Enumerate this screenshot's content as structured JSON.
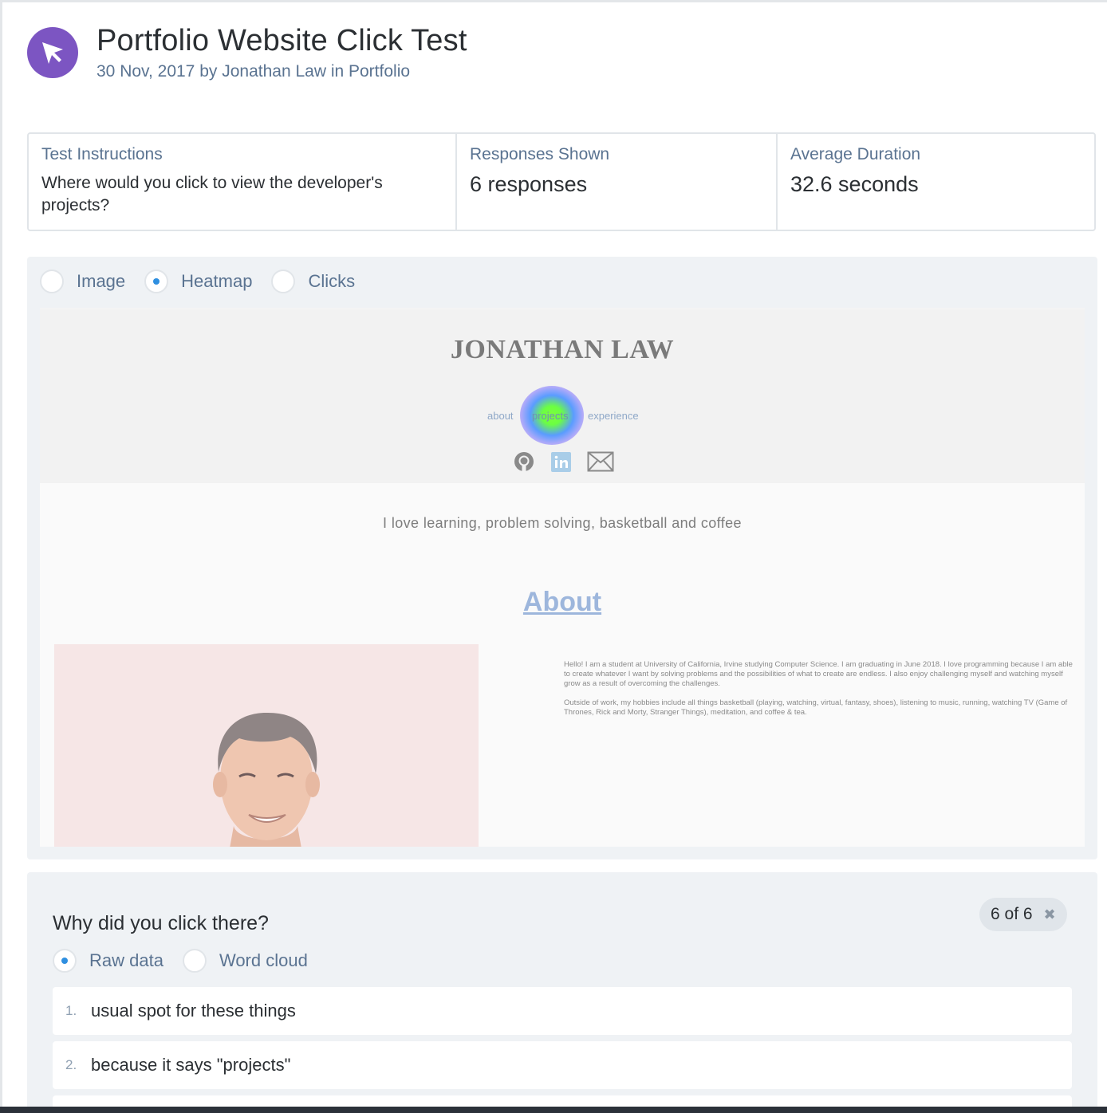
{
  "header": {
    "icon": "cursor-arrow-icon",
    "title": "Portfolio Website Click Test",
    "meta": "30 Nov, 2017 by Jonathan Law in Portfolio",
    "accent_color": "#7c55c2"
  },
  "stats": {
    "instructions_label": "Test Instructions",
    "instructions_text": "Where would you click to view the developer's projects?",
    "responses_label": "Responses Shown",
    "responses_value": "6 responses",
    "duration_label": "Average Duration",
    "duration_value": "32.6 seconds"
  },
  "view": {
    "options": [
      {
        "label": "Image",
        "selected": false
      },
      {
        "label": "Heatmap",
        "selected": true
      },
      {
        "label": "Clicks",
        "selected": false
      }
    ]
  },
  "screenshot": {
    "name": "JONATHAN LAW",
    "nav": [
      "about",
      "projects",
      "experience"
    ],
    "social_icons": [
      "github-icon",
      "linkedin-icon",
      "mail-icon"
    ],
    "tagline": "I love learning, problem solving, basketball and coffee",
    "about_heading": "About",
    "bio_1": "Hello! I am a student at University of California, Irvine studying Computer Science. I am graduating in June 2018. I love programming because I am able to create whatever I want by solving problems and the possibilities of what to create are endless. I also enjoy challenging myself and watching myself grow as a result of overcoming the challenges.",
    "bio_2": "Outside of work, my hobbies include all things basketball (playing, watching, virtual, fantasy, shoes), listening to music, running, watching TV (Game of Thrones, Rick and Morty, Stranger Things), meditation, and coffee & tea."
  },
  "question": {
    "title": "Why did you click there?",
    "count": "6 of 6",
    "options": [
      {
        "label": "Raw data",
        "selected": true
      },
      {
        "label": "Word cloud",
        "selected": false
      }
    ],
    "answers": [
      {
        "num": "1.",
        "text": "usual spot for these things"
      },
      {
        "num": "2.",
        "text": "because it says \"projects\""
      }
    ]
  }
}
